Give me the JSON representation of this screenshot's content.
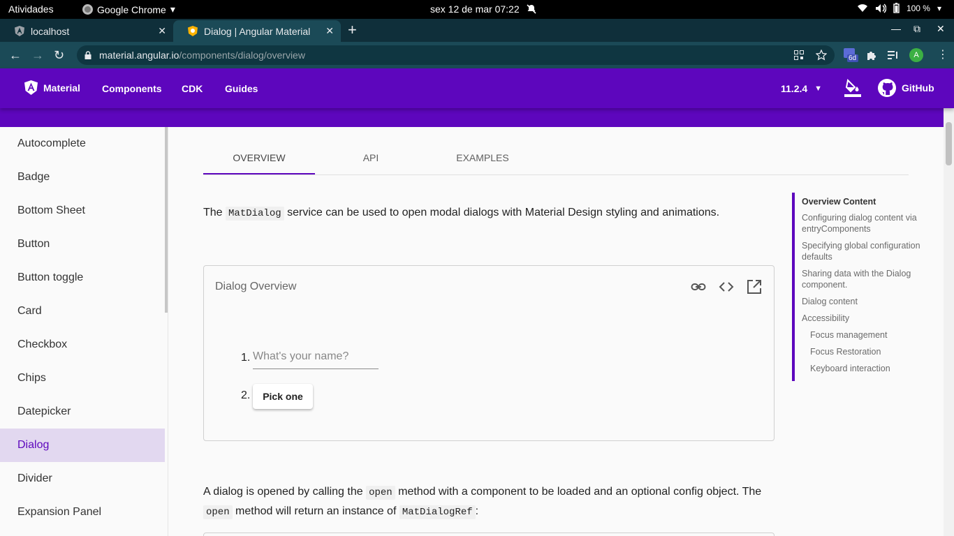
{
  "os": {
    "activities": "Atividades",
    "app_name": "Google Chrome",
    "clock": "sex 12 de mar  07:22",
    "battery": "100 %"
  },
  "browser": {
    "tabs": [
      {
        "title": "localhost",
        "active": false
      },
      {
        "title": "Dialog | Angular Material",
        "active": true
      }
    ],
    "url_host": "material.angular.io",
    "url_path": "/components/dialog/overview",
    "ext_badge": "6d",
    "profile_initial": "A"
  },
  "toolbar": {
    "brand": "Material",
    "nav": [
      "Components",
      "CDK",
      "Guides"
    ],
    "version": "11.2.4",
    "github": "GitHub"
  },
  "sidebar": {
    "items": [
      "Autocomplete",
      "Badge",
      "Bottom Sheet",
      "Button",
      "Button toggle",
      "Card",
      "Checkbox",
      "Chips",
      "Datepicker",
      "Dialog",
      "Divider",
      "Expansion Panel"
    ],
    "active": "Dialog"
  },
  "content_tabs": [
    "OVERVIEW",
    "API",
    "EXAMPLES"
  ],
  "intro": {
    "before": "The ",
    "code": "MatDialog",
    "after": " service can be used to open modal dialogs with Material Design styling and animations."
  },
  "example": {
    "title": "Dialog Overview",
    "item1_num": "1.",
    "item1_placeholder": "What's your name?",
    "item2_num": "2.",
    "item2_button": "Pick one"
  },
  "para2": {
    "p1": "A dialog is opened by calling the ",
    "c1": "open",
    "p2": " method with a component to be loaded and an optional config object. The",
    "c2": "open",
    "p3": " method will return an instance of ",
    "c3": "MatDialogRef",
    "p4": ":"
  },
  "toc": {
    "items": [
      "Overview Content",
      "Configuring dialog content via entryComponents",
      "Specifying global configuration defaults",
      "Sharing data with the Dialog component.",
      "Dialog content",
      "Accessibility",
      "Focus management",
      "Focus Restoration",
      "Keyboard interaction"
    ]
  },
  "colors": {
    "primary": "#5d06bd",
    "sidebar_active_bg": "#e2d8f0",
    "chrome_frame": "#0f2f3a",
    "chrome_toolbar": "#1b4a57"
  }
}
